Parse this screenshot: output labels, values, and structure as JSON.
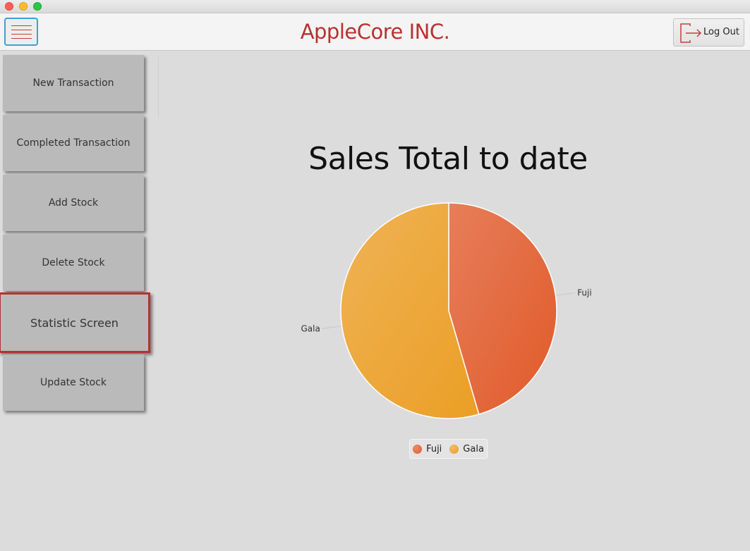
{
  "window": {
    "app_title": "AppleCore INC."
  },
  "header": {
    "menu_icon": "hamburger-menu-icon",
    "logout_label": "Log Out",
    "logout_icon": "logout-icon"
  },
  "sidebar": {
    "items": [
      {
        "label": "New Transaction"
      },
      {
        "label": "Completed Transaction"
      },
      {
        "label": "Add Stock"
      },
      {
        "label": "Delete Stock"
      },
      {
        "label": "Statistic Screen",
        "selected": true
      },
      {
        "label": "Update Stock"
      }
    ]
  },
  "colors": {
    "brand": "#b8312f",
    "fuji": "#e05a2a",
    "gala": "#eb9e25"
  },
  "chart_data": {
    "type": "pie",
    "title": "Sales Total to date",
    "series": [
      {
        "name": "Fuji",
        "value": 45.5,
        "color": "#e05a2a"
      },
      {
        "name": "Gala",
        "value": 54.5,
        "color": "#eb9e25"
      }
    ],
    "legend": "bottom"
  }
}
